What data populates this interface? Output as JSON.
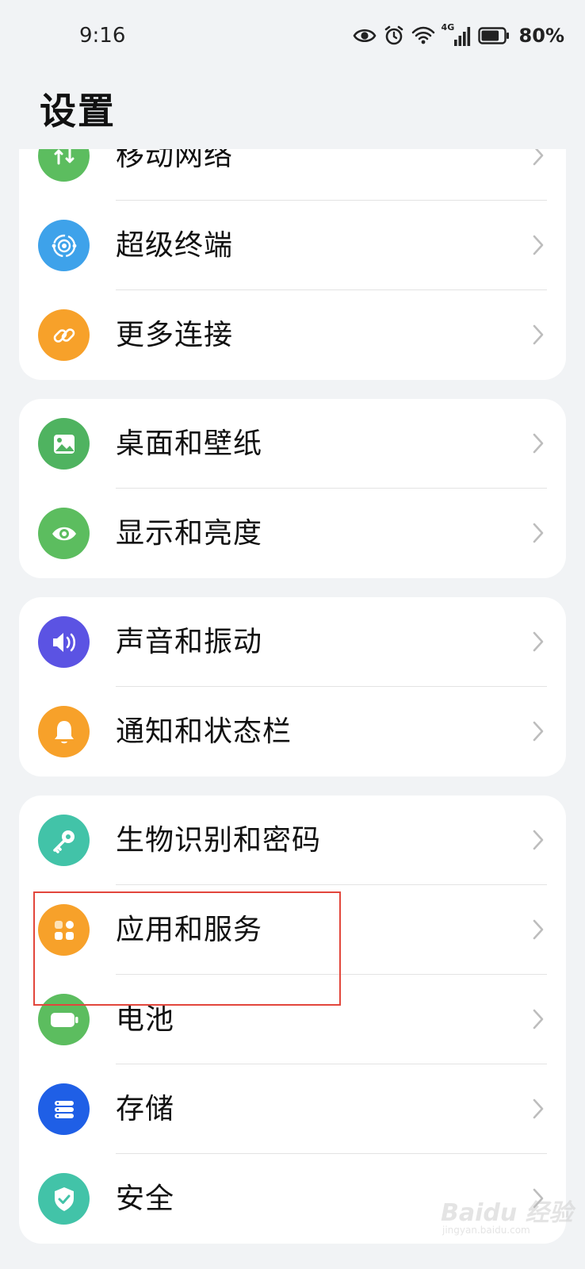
{
  "status": {
    "time": "9:16",
    "network_label": "4G",
    "battery_pct": "80%",
    "battery_level": 0.8,
    "icons": [
      "eye-icon",
      "alarm-icon",
      "wifi-icon",
      "signal-icon",
      "battery-icon"
    ]
  },
  "header": {
    "title": "设置"
  },
  "groups": [
    {
      "items": [
        {
          "label": "移动网络",
          "icon": "mobile-network-icon",
          "color": "#5cbd5f"
        },
        {
          "label": "超级终端",
          "icon": "super-device-icon",
          "color": "#3ea2ea"
        },
        {
          "label": "更多连接",
          "icon": "link-icon",
          "color": "#f7a12a"
        }
      ]
    },
    {
      "items": [
        {
          "label": "桌面和壁纸",
          "icon": "wallpaper-icon",
          "color": "#4fb360"
        },
        {
          "label": "显示和亮度",
          "icon": "display-eye-icon",
          "color": "#5cbd5f"
        }
      ]
    },
    {
      "items": [
        {
          "label": "声音和振动",
          "icon": "sound-icon",
          "color": "#5b53e3"
        },
        {
          "label": "通知和状态栏",
          "icon": "bell-icon",
          "color": "#f7a12a"
        }
      ]
    },
    {
      "items": [
        {
          "label": "生物识别和密码",
          "icon": "key-icon",
          "color": "#42c3a8"
        },
        {
          "label": "应用和服务",
          "icon": "apps-icon",
          "color": "#f7a12a"
        },
        {
          "label": "电池",
          "icon": "battery-icon",
          "color": "#5cbd5f"
        },
        {
          "label": "存储",
          "icon": "storage-icon",
          "color": "#1f5fe6"
        },
        {
          "label": "安全",
          "icon": "shield-icon",
          "color": "#42c3a8"
        }
      ]
    }
  ],
  "watermark": {
    "text": "Baidu 经验",
    "sub": "jingyan.baidu.com"
  },
  "colors": {
    "background": "#f1f3f5",
    "card": "#ffffff",
    "highlight": "#e2463c"
  }
}
